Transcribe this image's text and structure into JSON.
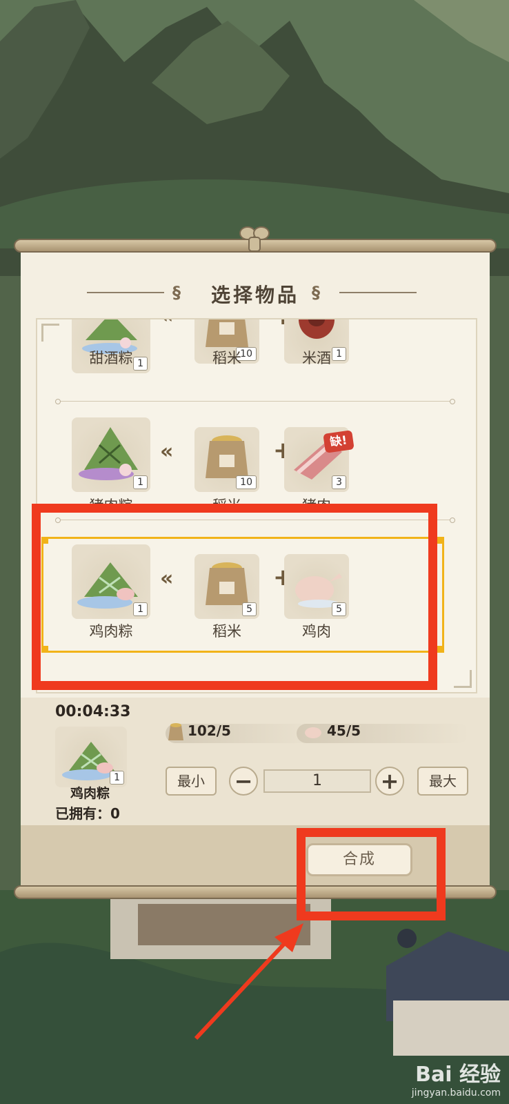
{
  "dialog": {
    "title": "选择物品"
  },
  "recipes": [
    {
      "product": {
        "name": "甜酒粽",
        "qty": "1"
      },
      "ingredients": [
        {
          "name": "稻米",
          "qty": "10"
        },
        {
          "name": "米酒",
          "qty": "1"
        }
      ]
    },
    {
      "product": {
        "name": "猪肉粽",
        "qty": "1"
      },
      "ingredients": [
        {
          "name": "稻米",
          "qty": "10"
        },
        {
          "name": "猪肉",
          "qty": "3",
          "badge": "缺!"
        }
      ]
    },
    {
      "product": {
        "name": "鸡肉粽",
        "qty": "1"
      },
      "ingredients": [
        {
          "name": "稻米",
          "qty": "5"
        },
        {
          "name": "鸡肉",
          "qty": "5"
        }
      ],
      "selected": true
    }
  ],
  "detail": {
    "timer": "00:04:33",
    "resources": [
      {
        "icon": "rice-sack-icon",
        "value": "102/5"
      },
      {
        "icon": "chicken-icon",
        "value": "45/5"
      }
    ],
    "selected_item": {
      "name": "鸡肉粽",
      "qty": "1"
    },
    "owned_label": "已拥有：0",
    "min_label": "最小",
    "max_label": "最大",
    "minus": "−",
    "plus": "+",
    "quantity": "1",
    "craft_label": "合成"
  },
  "watermark": {
    "brand": "Bai 经验",
    "url": "jingyan.baidu.com"
  },
  "colors": {
    "annotation_red": "#ef3a1e",
    "selection_gold": "#f1b319",
    "panel_paper": "#f4efe2"
  }
}
